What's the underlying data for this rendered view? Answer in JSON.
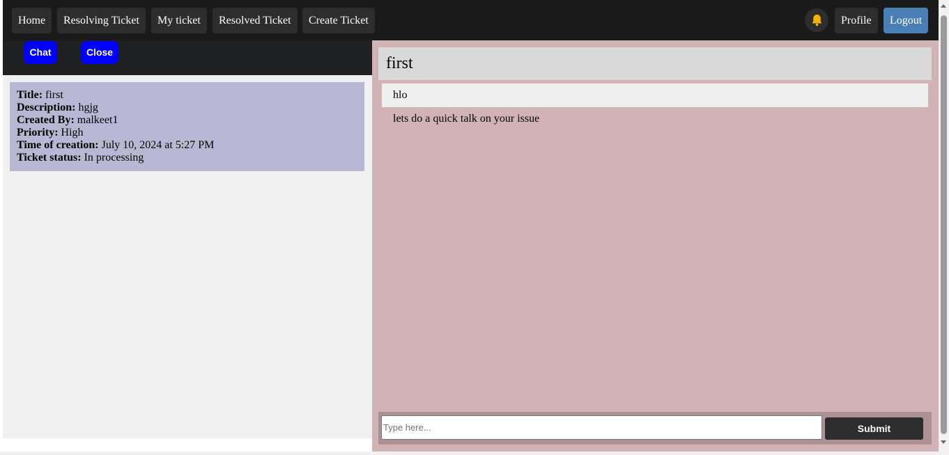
{
  "nav": {
    "items": [
      "Home",
      "Resolving Ticket",
      "My ticket",
      "Resolved Ticket",
      "Create Ticket"
    ],
    "profile_label": "Profile",
    "logout_label": "Logout",
    "bell_icon": "bell-icon"
  },
  "actions": {
    "chat_label": "Chat",
    "close_label": "Close"
  },
  "ticket": {
    "title_label": "Title:",
    "title": "first",
    "description_label": "Description:",
    "description": "hgjg",
    "created_by_label": "Created By:",
    "created_by": "malkeet1",
    "priority_label": "Priority:",
    "priority": "High",
    "time_label": "Time of creation:",
    "time": "July 10, 2024 at 5:27 PM",
    "status_label": "Ticket status:",
    "status": "In processing"
  },
  "chat": {
    "title": "first",
    "messages": [
      "hlo",
      "lets do a quick talk on your issue"
    ],
    "input_placeholder": "Type here...",
    "input_value": "",
    "submit_label": "Submit"
  },
  "colors": {
    "navbar": "#1a1a1a",
    "action_button": "#0000ff",
    "ticket_card": "#b8b8d4",
    "chat_panel": "#d1b3b5",
    "logout": "#4a7fb5",
    "bell": "#f5b400"
  }
}
